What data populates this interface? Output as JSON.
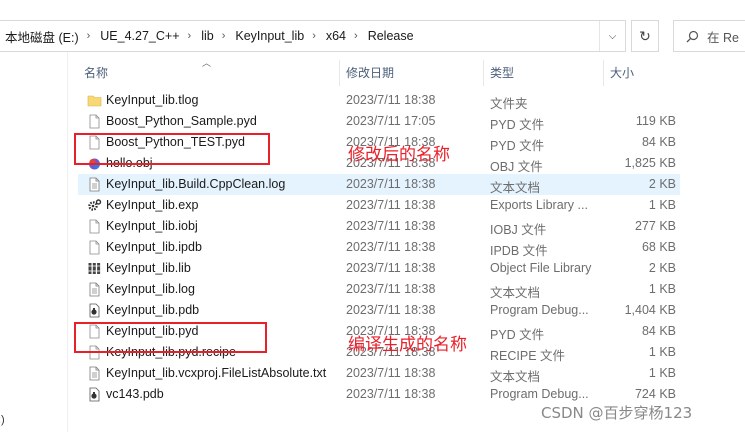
{
  "breadcrumb": [
    "本地磁盘 (E:)",
    "UE_4.27_C++",
    "lib",
    "KeyInput_lib",
    "x64",
    "Release"
  ],
  "search": {
    "placeholder": "在 Re"
  },
  "columns": {
    "name": "名称",
    "date": "修改日期",
    "type": "类型",
    "size": "大小"
  },
  "files": [
    {
      "name": "KeyInput_lib.tlog",
      "date": "2023/7/11 18:38",
      "type": "文件夹",
      "size": "",
      "icon": "folder-icon"
    },
    {
      "name": "Boost_Python_Sample.pyd",
      "date": "2023/7/11 17:05",
      "type": "PYD 文件",
      "size": "119 KB",
      "icon": "file-icon"
    },
    {
      "name": "Boost_Python_TEST.pyd",
      "date": "2023/7/11 18:38",
      "type": "PYD 文件",
      "size": "84 KB",
      "icon": "file-icon"
    },
    {
      "name": "hello.obj",
      "date": "2023/7/11 18:38",
      "type": "OBJ 文件",
      "size": "1,825 KB",
      "icon": "obj-icon"
    },
    {
      "name": "KeyInput_lib.Build.CppClean.log",
      "date": "2023/7/11 18:38",
      "type": "文本文档",
      "size": "2 KB",
      "icon": "text-file-icon"
    },
    {
      "name": "KeyInput_lib.exp",
      "date": "2023/7/11 18:38",
      "type": "Exports Library ...",
      "size": "1 KB",
      "icon": "gear-file-icon"
    },
    {
      "name": "KeyInput_lib.iobj",
      "date": "2023/7/11 18:38",
      "type": "IOBJ 文件",
      "size": "277 KB",
      "icon": "file-icon"
    },
    {
      "name": "KeyInput_lib.ipdb",
      "date": "2023/7/11 18:38",
      "type": "IPDB 文件",
      "size": "68 KB",
      "icon": "file-icon"
    },
    {
      "name": "KeyInput_lib.lib",
      "date": "2023/7/11 18:38",
      "type": "Object File Library",
      "size": "2 KB",
      "icon": "library-icon"
    },
    {
      "name": "KeyInput_lib.log",
      "date": "2023/7/11 18:38",
      "type": "文本文档",
      "size": "1 KB",
      "icon": "text-file-icon"
    },
    {
      "name": "KeyInput_lib.pdb",
      "date": "2023/7/11 18:38",
      "type": "Program Debug...",
      "size": "1,404 KB",
      "icon": "pdb-icon"
    },
    {
      "name": "KeyInput_lib.pyd",
      "date": "2023/7/11 18:38",
      "type": "PYD 文件",
      "size": "84 KB",
      "icon": "file-icon"
    },
    {
      "name": "KeyInput_lib.pyd.recipe",
      "date": "2023/7/11 18:38",
      "type": "RECIPE 文件",
      "size": "1 KB",
      "icon": "file-icon"
    },
    {
      "name": "KeyInput_lib.vcxproj.FileListAbsolute.txt",
      "date": "2023/7/11 18:38",
      "type": "文本文档",
      "size": "1 KB",
      "icon": "text-file-icon"
    },
    {
      "name": "vc143.pdb",
      "date": "2023/7/11 18:38",
      "type": "Program Debug...",
      "size": "724 KB",
      "icon": "pdb-icon"
    }
  ],
  "highlighted_row_index": 4,
  "annotations": {
    "renamed": "修改后的名称",
    "generated": "编译生成的名称"
  },
  "watermark": "CSDN @百步穿杨123",
  "left_fragment": ":)",
  "colors": {
    "annotation_red": "#e8202a",
    "row_highlight": "#e5f3ff",
    "folder": "#f8d775",
    "header_text": "#4c607a"
  }
}
